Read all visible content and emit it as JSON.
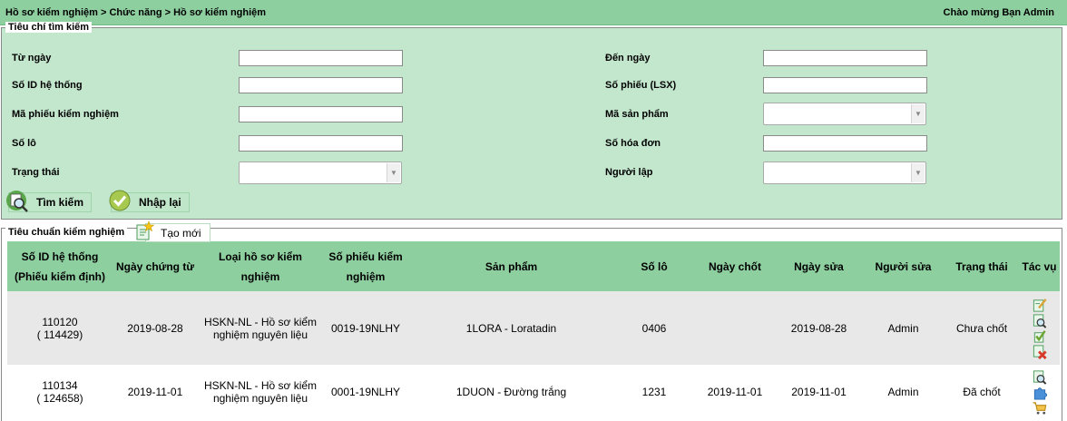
{
  "header": {
    "breadcrumb": "Hồ sơ kiểm nghiệm > Chức năng > Hồ sơ kiểm nghiệm",
    "greeting": "Chào mừng Bạn Admin"
  },
  "search": {
    "legend": "Tiêu chí tìm kiếm",
    "from_date_label": "Từ ngày",
    "to_date_label": "Đến ngày",
    "system_id_label": "Số ID hệ thống",
    "slip_no_label": "Số phiếu (LSX)",
    "test_slip_code_label": "Mã phiếu kiểm nghiệm",
    "product_code_label": "Mã sản phẩm",
    "lot_no_label": "Số lô",
    "invoice_no_label": "Số hóa đơn",
    "status_label": "Trạng thái",
    "creator_label": "Người lập",
    "search_button": "Tìm kiếm",
    "reset_button": "Nhập lại"
  },
  "results": {
    "legend": "Tiêu chuẩn kiểm nghiệm",
    "new_button": "Tạo mới",
    "columns": [
      "Số ID hệ thống (Phiếu kiểm định)",
      "Ngày chứng từ",
      "Loại hồ sơ kiểm nghiệm",
      "Số phiếu kiểm nghiệm",
      "Sản phẩm",
      "Số lô",
      "Ngày chốt",
      "Ngày sửa",
      "Người sửa",
      "Trạng thái",
      "Tác vụ"
    ],
    "rows": [
      {
        "id": "110120",
        "sub_id": "( 114429)",
        "doc_date": "2019-08-28",
        "type": "HSKN-NL - Hồ sơ kiểm nghiệm nguyên liệu",
        "slip_no": "0019-19NLHY",
        "product": "1LORA - Loratadin",
        "lot": "0406",
        "close_date": "",
        "edit_date": "2019-08-28",
        "editor": "Admin",
        "status": "Chưa chốt"
      },
      {
        "id": "110134",
        "sub_id": "( 124658)",
        "doc_date": "2019-11-01",
        "type": "HSKN-NL - Hồ sơ kiểm nghiệm nguyên liệu",
        "slip_no": "0001-19NLHY",
        "product": "1DUON - Đường trắng",
        "lot": "1231",
        "close_date": "2019-11-01",
        "edit_date": "2019-11-01",
        "editor": "Admin",
        "status": "Đã chốt"
      }
    ]
  },
  "colors": {
    "header_green": "#8ecf9f",
    "panel_green": "#c3e7cd",
    "row_grey": "#e8e8e8"
  },
  "icons": [
    "search-icon",
    "check-icon",
    "new-doc-icon",
    "edit-icon",
    "view-icon",
    "approve-icon",
    "delete-icon",
    "puzzle-icon",
    "cart-icon"
  ]
}
